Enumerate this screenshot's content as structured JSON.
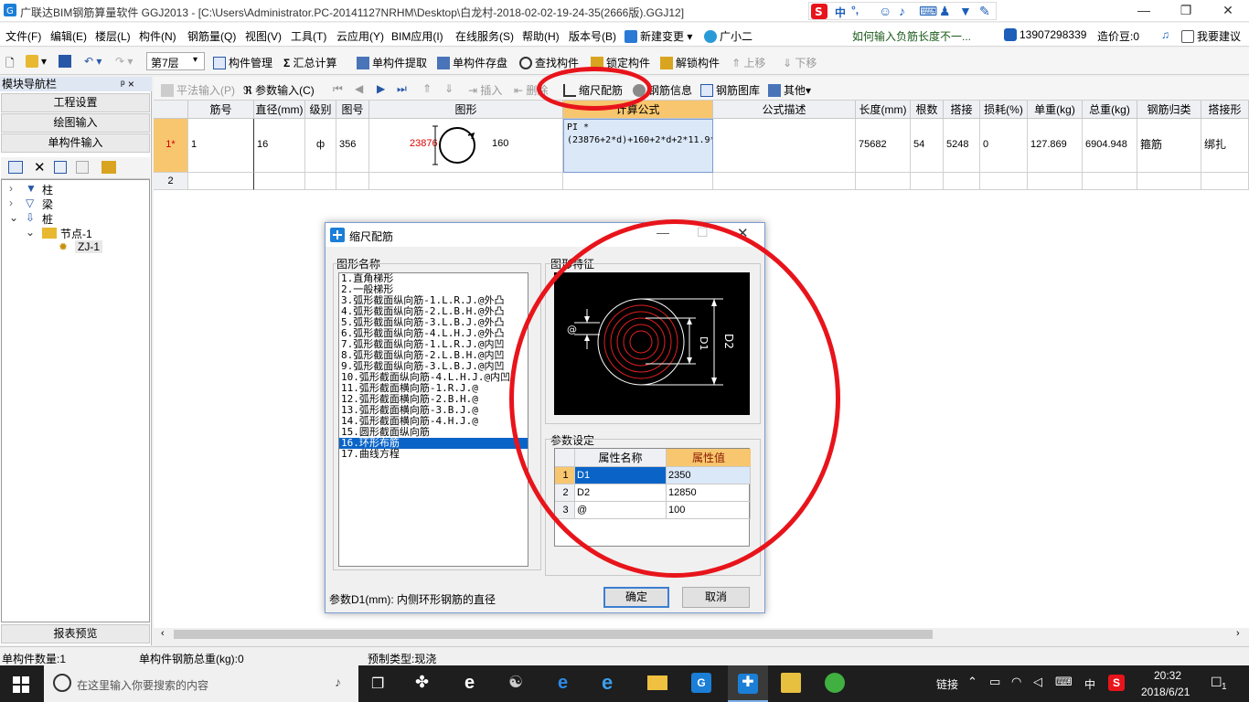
{
  "window": {
    "title": "广联达BIM钢筋算量软件 GGJ2013 - [C:\\Users\\Administrator.PC-20141127NRHM\\Desktop\\白龙村-2018-02-02-19-24-35(2666版).GGJ12]",
    "ime": [
      "中",
      "°,"
    ]
  },
  "menu": {
    "items": [
      "文件(F)",
      "编辑(E)",
      "楼层(L)",
      "构件(N)",
      "钢筋量(Q)",
      "视图(V)",
      "工具(T)",
      "云应用(Y)",
      "BIM应用(I)",
      "在线服务(S)",
      "帮助(H)",
      "版本号(B)",
      "新建变更",
      "广小二"
    ],
    "hint": "如何输入负筋长度不一...",
    "phone": "13907298339",
    "price": "造价豆:0",
    "suggest": "我要建议"
  },
  "toolbar1": {
    "floor": "第7层",
    "items": [
      "构件管理",
      "汇总计算",
      "单构件提取",
      "单构件存盘",
      "查找构件",
      "锁定构件",
      "解锁构件",
      "上移",
      "下移"
    ]
  },
  "nav": {
    "title": "模块导航栏",
    "pin": "ᵖ ×",
    "buttons": [
      "工程设置",
      "绘图输入",
      "单构件输入"
    ],
    "footer": "报表预览",
    "tree": [
      "柱",
      "梁",
      "桩",
      "节点-1",
      "ZJ-1"
    ]
  },
  "toolbar2": {
    "items": [
      "平法输入(P)",
      "参数输入(C)",
      "插入",
      "删除",
      "缩尺配筋",
      "钢筋信息",
      "钢筋图库",
      "其他"
    ]
  },
  "grid": {
    "headers": [
      "筋号",
      "直径(mm)",
      "级别",
      "图号",
      "图形",
      "计算公式",
      "公式描述",
      "长度(mm)",
      "根数",
      "搭接",
      "损耗(%)",
      "单重(kg)",
      "总重(kg)",
      "钢筋归类",
      "搭接形"
    ],
    "rows": [
      {
        "idx": "1*",
        "jh": "1",
        "d": "16",
        "grade": "ф",
        "tu": "356",
        "shape_a": "23876",
        "shape_b": "160",
        "formula": "PI *(23876+2*d)+160+2*d+2*11.9*d",
        "desc": "",
        "len": "75682",
        "count": "54",
        "lap": "5248",
        "loss": "0",
        "unit": "127.869",
        "total": "6904.948",
        "cat": "箍筋",
        "laptype": "绑扎"
      },
      {
        "idx": "2"
      }
    ]
  },
  "dialog": {
    "title": "缩尺配筋",
    "list_label": "图形名称",
    "shapes": [
      "1.直角梯形",
      "2.一般梯形",
      "3.弧形截面纵向筋-1.L.R.J.@外凸",
      "4.弧形截面纵向筋-2.L.B.H.@外凸",
      "5.弧形截面纵向筋-3.L.B.J.@外凸",
      "6.弧形截面纵向筋-4.L.H.J.@外凸",
      "7.弧形截面纵向筋-1.L.R.J.@内凹",
      "8.弧形截面纵向筋-2.L.B.H.@内凹",
      "9.弧形截面纵向筋-3.L.B.J.@内凹",
      "10.弧形截面纵向筋-4.L.H.J.@内凹",
      "11.弧形截面横向筋-1.R.J.@",
      "12.弧形截面横向筋-2.B.H.@",
      "13.弧形截面横向筋-3.B.J.@",
      "14.弧形截面横向筋-4.H.J.@",
      "15.圆形截面纵向筋",
      "16.环形布筋",
      "17.曲线方程"
    ],
    "selected": 15,
    "feature_label": "图形特征",
    "preview": {
      "at": "@",
      "d1": "D1",
      "d2": "D2"
    },
    "param_label": "参数设定",
    "param_headers": [
      "属性名称",
      "属性值"
    ],
    "params": [
      {
        "i": "1",
        "name": "D1",
        "value": "2350"
      },
      {
        "i": "2",
        "name": "D2",
        "value": "12850"
      },
      {
        "i": "3",
        "name": "@",
        "value": "100"
      }
    ],
    "hint": "参数D1(mm): 内侧环形钢筋的直径",
    "ok": "确定",
    "cancel": "取消"
  },
  "status": {
    "count": "单构件数量:1",
    "weight": "单构件钢筋总重(kg):0",
    "type": "预制类型:现浇"
  },
  "taskbar": {
    "search": "在这里输入你要搜索的内容",
    "link": "链接",
    "lang": "中",
    "time": "20:32",
    "date": "2018/6/21",
    "notif": "1"
  },
  "colors": {
    "accent_red": "#e8141b",
    "selection": "#0a64c8",
    "header_orange": "#f7c66e"
  }
}
